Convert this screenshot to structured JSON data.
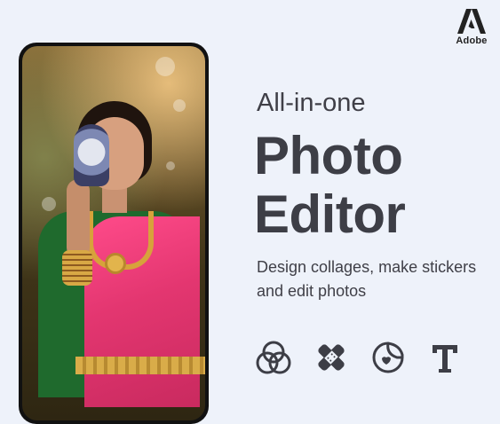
{
  "brand": {
    "name": "Adobe"
  },
  "hero": {
    "subtitle": "All-in-one",
    "title_line_1": "Photo",
    "title_line_2": "Editor",
    "description_line_1": "Design collages, make stickers",
    "description_line_2": "and edit photos"
  },
  "features": [
    {
      "icon": "layers-circles-icon"
    },
    {
      "icon": "sticker-bandage-icon"
    },
    {
      "icon": "sticker-peel-icon"
    },
    {
      "icon": "text-icon"
    }
  ],
  "colors": {
    "background": "#eef2fa",
    "text": "#3d3e46",
    "phone_frame": "#111111"
  }
}
